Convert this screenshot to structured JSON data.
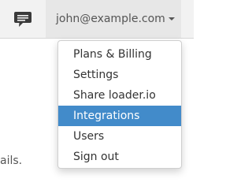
{
  "header": {
    "messages_icon": "chat-bubble-icon",
    "account": {
      "email": "john@example.com",
      "caret_icon": "caret-down-icon"
    }
  },
  "dropdown": {
    "items": [
      {
        "label": "Plans & Billing",
        "active": false
      },
      {
        "label": "Settings",
        "active": false
      },
      {
        "label": "Share loader.io",
        "active": false
      },
      {
        "label": "Integrations",
        "active": true
      },
      {
        "label": "Users",
        "active": false
      },
      {
        "label": "Sign out",
        "active": false
      }
    ]
  },
  "page": {
    "partial_text": "ails."
  },
  "colors": {
    "topbar_bg": "#f2f2f2",
    "toggle_bg": "#e7e7e7",
    "active_item_bg": "#428bca"
  }
}
